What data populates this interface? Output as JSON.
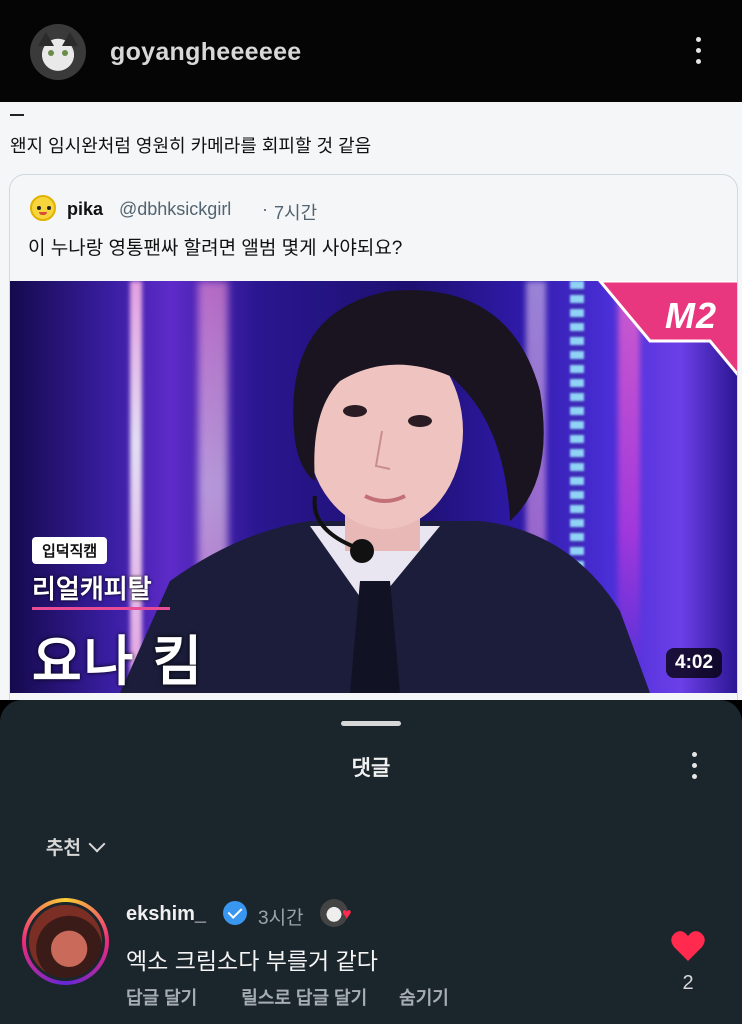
{
  "header": {
    "username": "goyangheeeeee",
    "avatar_icon": "cat-avatar",
    "menu_icon": "more-vertical-icon"
  },
  "post": {
    "tweet_text": "왠지 임시완처럼 영원히 카메라를 회피할 것 같음",
    "quoted": {
      "name": "pika",
      "handle": "@dbhksickgirl",
      "separator": "·",
      "time": "7시간",
      "text": "이 누나랑 영통팬싸 할려면 앨범 몇게 사야되요?",
      "video": {
        "brand_logo": "M2",
        "tag": "입덕직캠",
        "subtitle": "리얼캐피탈",
        "name_overlay": "요나 킴",
        "duration": "4:02"
      }
    }
  },
  "comments_sheet": {
    "title": "댓글",
    "sort_label": "추천",
    "comments": [
      {
        "username": "ekshim_",
        "verified": true,
        "time": "3시간",
        "text": "엑소 크림소다 부를거 같다",
        "actions": [
          "답글 달기",
          "릴스로 답글 달기",
          "숨기기"
        ],
        "like_count": "2",
        "liked": true
      }
    ]
  },
  "colors": {
    "sheet_bg": "#1b252c",
    "like_red": "#ff2a4d",
    "verified_blue": "#3a97f0"
  }
}
